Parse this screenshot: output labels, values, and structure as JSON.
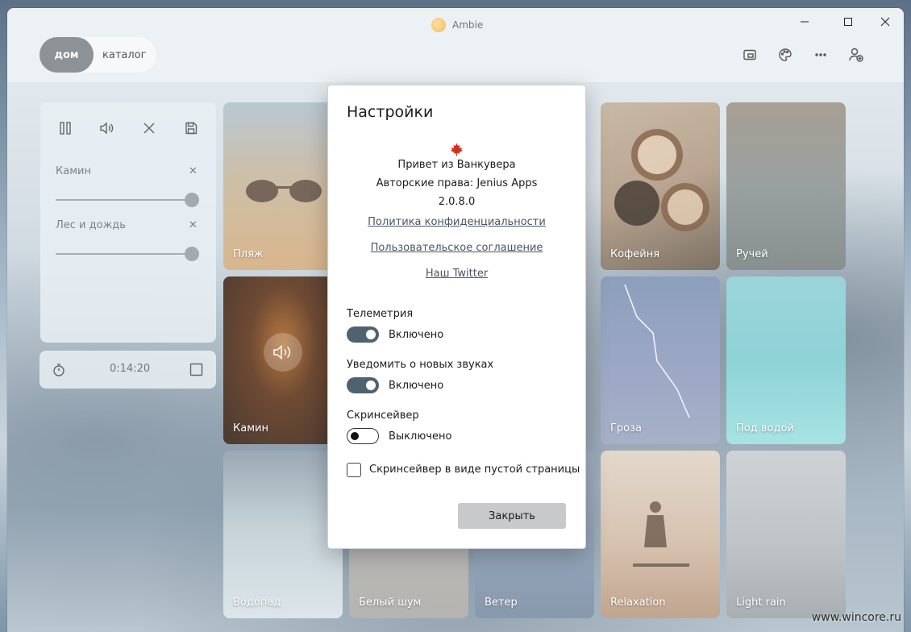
{
  "window": {
    "title": "Ambie"
  },
  "nav": {
    "home": "дом",
    "catalog": "каталог"
  },
  "player": {
    "sounds": [
      {
        "name": "Камин",
        "volume_percent": 100
      },
      {
        "name": "Лес и дождь",
        "volume_percent": 100
      }
    ],
    "timer": "0:14:20"
  },
  "tiles": [
    {
      "label": "Пляж"
    },
    {
      "label": "Кофейня"
    },
    {
      "label": "Ручей"
    },
    {
      "label": "Камин"
    },
    {
      "label": "Гроза"
    },
    {
      "label": "Под водой"
    },
    {
      "label": "Водопад"
    },
    {
      "label": "Белый шум"
    },
    {
      "label": "Ветер"
    },
    {
      "label": "Relaxation"
    },
    {
      "label": "Light rain"
    }
  ],
  "settings": {
    "title": "Настройки",
    "greeting": "Привет из Ванкувера",
    "copyright": "Авторские права: Jenius Apps",
    "version": "2.0.8.0",
    "links": {
      "privacy": "Политика конфиденциальности",
      "terms": "Пользовательское соглашение",
      "twitter": "Наш Twitter"
    },
    "telemetry": {
      "label": "Телеметрия",
      "state": "Включено",
      "on": true
    },
    "notify": {
      "label": "Уведомить о новых звуках",
      "state": "Включено",
      "on": true
    },
    "screensaver": {
      "label": "Скринсейвер",
      "state": "Выключено",
      "on": false
    },
    "blank_screensaver": {
      "label": "Скринсейвер в виде пустой страницы",
      "checked": false
    },
    "close_button": "Закрыть"
  },
  "watermark": "www.wincore.ru",
  "colors": {
    "accent": "#4f6270",
    "nav_active": "#8d9297",
    "maple": "#d0301e"
  }
}
